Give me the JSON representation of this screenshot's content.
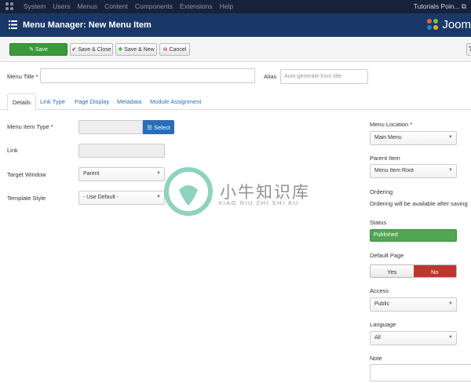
{
  "topnav": {
    "menu": [
      "System",
      "Users",
      "Menus",
      "Content",
      "Components",
      "Extensions",
      "Help"
    ],
    "site_label": "Tutorials Poin..."
  },
  "header": {
    "title": "Menu Manager: New Menu Item",
    "brand": "Joom"
  },
  "toolbar": {
    "save": "Save",
    "save_close": "Save & Close",
    "save_new": "Save & New",
    "cancel": "Cancel"
  },
  "form": {
    "menu_title_label": "Menu Title *",
    "menu_title_value": "",
    "alias_label": "Alias",
    "alias_placeholder": "Auto-generate from title"
  },
  "tabs": [
    "Details",
    "Link Type",
    "Page Display",
    "Metadata",
    "Module Assignment"
  ],
  "details": {
    "menu_item_type_label": "Menu Item Type *",
    "select_button": "Select",
    "link_label": "Link",
    "target_window_label": "Target Window",
    "target_window_value": "Parent",
    "template_style_label": "Template Style",
    "template_style_value": "- Use Default -"
  },
  "sidebar": {
    "menu_location_label": "Menu Location *",
    "menu_location_value": "Main Menu",
    "parent_item_label": "Parent Item",
    "parent_item_value": "Menu Item Root",
    "ordering_label": "Ordering",
    "ordering_text": "Ordering will be available after saving",
    "status_label": "Status",
    "status_value": "Published",
    "default_page_label": "Default Page",
    "default_yes": "Yes",
    "default_no": "No",
    "access_label": "Access",
    "access_value": "Public",
    "language_label": "Language",
    "language_value": "All",
    "note_label": "Note"
  },
  "watermark": {
    "title": "小牛知识库",
    "subtitle": "XIAO NIU ZHI SHI KU"
  },
  "colors": {
    "nav": "#17213a",
    "header": "#1a3867",
    "save": "#3a9a3a",
    "link": "#2a6db5",
    "no": "#bd362f",
    "published": "#52a552"
  }
}
